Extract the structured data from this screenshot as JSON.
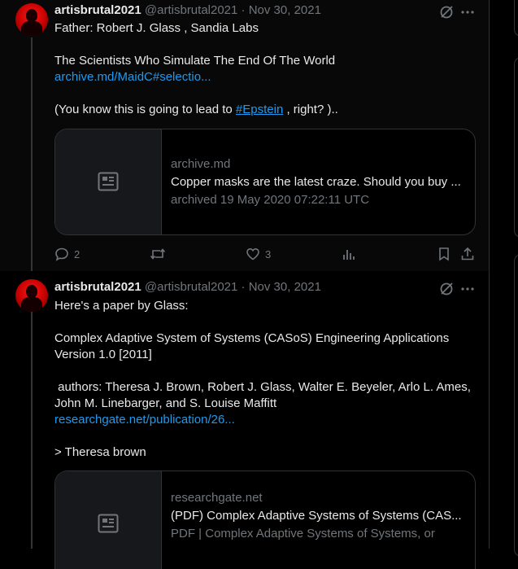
{
  "tweets": [
    {
      "author": {
        "name": "artisbrutal2021",
        "handle": "@artisbrutal2021",
        "separator": "·",
        "date": "Nov 30, 2021"
      },
      "text": {
        "l1": "Father: Robert J. Glass , Sandia Labs",
        "l2": "The Scientists Who Simulate The End Of The World",
        "link": "archive.md/MaidC#selectio...",
        "l3_before": "(You know this is going to lead to ",
        "hashtag": "#Epstein",
        "l3_after": " , right? ).."
      },
      "card": {
        "domain": "archive.md",
        "title": "Copper masks are the latest craze. Should you buy ...",
        "description": "archived 19 May 2020 07:22:11 UTC",
        "icon": "article-icon"
      },
      "actions": {
        "replies": "2",
        "reposts": "",
        "likes": "3"
      }
    },
    {
      "author": {
        "name": "artisbrutal2021",
        "handle": "@artisbrutal2021",
        "separator": "·",
        "date": "Nov 30, 2021"
      },
      "text": {
        "l1": "Here's a paper by Glass:",
        "l2": "Complex Adaptive System of Systems (CASoS) Engineering Applications",
        "l3": "Version 1.0 [2011]",
        "l4": " authors: Theresa J. Brown, Robert J. Glass, Walter E. Beyeler, Arlo L. Ames,",
        "l5": "John M. Linebarger, and S. Louise Maffitt",
        "link": "researchgate.net/publication/26...",
        "l6": "> Theresa brown"
      },
      "card": {
        "domain": "researchgate.net",
        "title": "(PDF) Complex Adaptive Systems of Systems (CAS...",
        "description": "PDF | Complex Adaptive Systems of Systems, or",
        "icon": "article-icon"
      }
    }
  ],
  "colors": {
    "link": "#1d9bf0",
    "muted": "#71767b",
    "text": "#e7e9ea",
    "border": "#2f3336"
  }
}
